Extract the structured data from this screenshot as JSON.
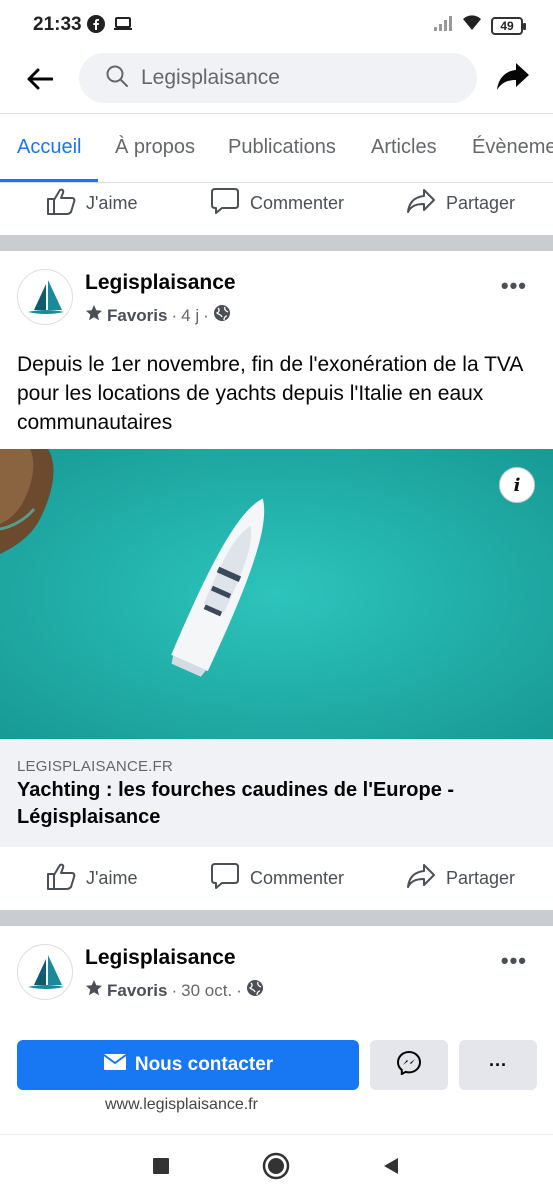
{
  "status_bar": {
    "time": "21:33",
    "battery": "49",
    "icons": [
      "facebook-icon",
      "laptop-icon",
      "signal-icon",
      "wifi-icon",
      "battery-icon"
    ]
  },
  "top_bar": {
    "search_text": "Legisplaisance",
    "icons": [
      "back-arrow-icon",
      "search-icon",
      "share-arrow-icon"
    ]
  },
  "tabs": [
    {
      "label": "Accueil",
      "active": true
    },
    {
      "label": "À propos",
      "active": false
    },
    {
      "label": "Publications",
      "active": false
    },
    {
      "label": "Articles",
      "active": false
    },
    {
      "label": "Évèneme",
      "active": false
    }
  ],
  "actions": {
    "like": "J'aime",
    "comment": "Commenter",
    "share": "Partager"
  },
  "post1": {
    "author": "Legisplaisance",
    "favorites": "Favoris",
    "time": "4 j",
    "text": "Depuis le 1er novembre, fin de l'exonération de la TVA pour les locations de yachts depuis l'Italie en eaux communautaires",
    "link_domain": "LEGISPLAISANCE.FR",
    "link_title": "Yachting : les fourches caudines de l'Europe - Légisplaisance",
    "info_label": "i"
  },
  "post2": {
    "author": "Legisplaisance",
    "favorites": "Favoris",
    "time": "30 oct."
  },
  "cta": {
    "contact_label": "Nous contacter",
    "more_label": "···",
    "website": "www.legisplaisance.fr"
  },
  "colors": {
    "accent": "#1877f2",
    "separator": "#c9ccd1",
    "sea": "#21b3ae"
  }
}
